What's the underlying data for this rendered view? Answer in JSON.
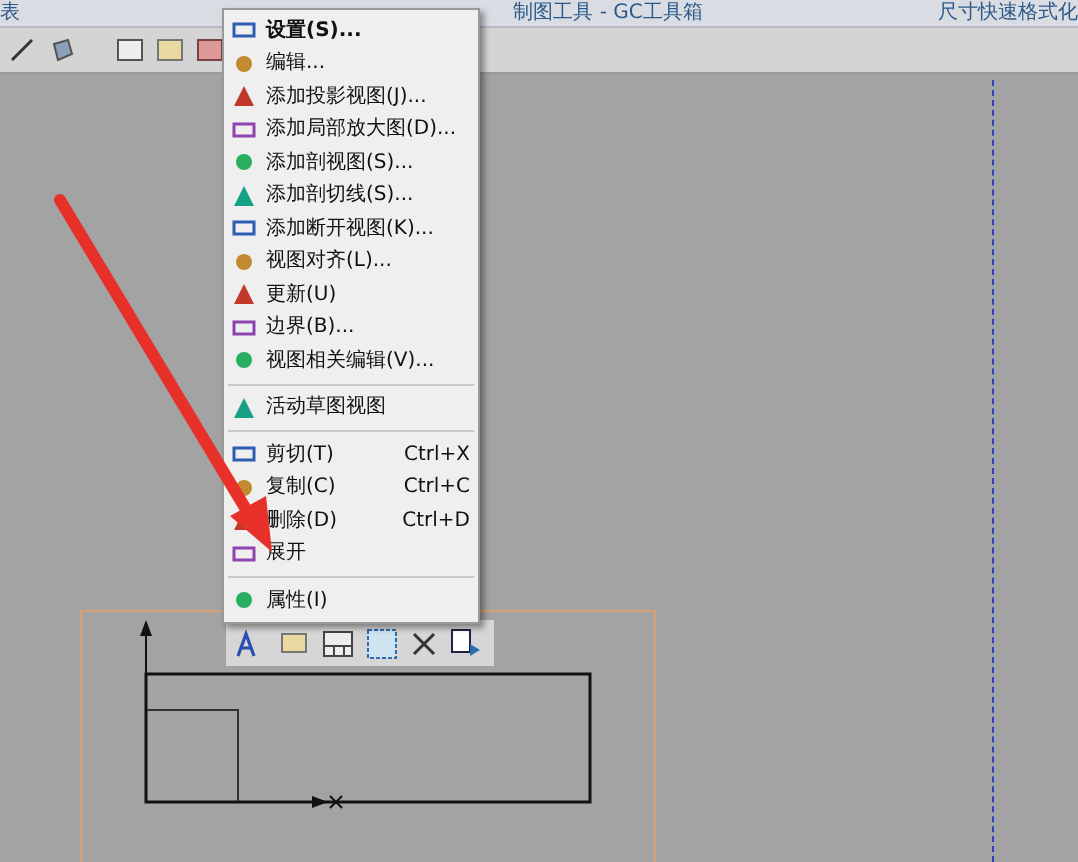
{
  "top_bar": {
    "segments": [
      {
        "text": "表"
      },
      {
        "text": "制图工具 - GC工具箱"
      },
      {
        "text": "尺寸快速格式化"
      }
    ]
  },
  "context_menu": {
    "items": [
      {
        "kind": "item",
        "label": "设置(S)...",
        "default": true
      },
      {
        "kind": "item",
        "label": "编辑...",
        "default": false
      },
      {
        "kind": "item",
        "label": "添加投影视图(J)...",
        "default": false
      },
      {
        "kind": "item",
        "label": "添加局部放大图(D)...",
        "default": false
      },
      {
        "kind": "item",
        "label": "添加剖视图(S)...",
        "default": false
      },
      {
        "kind": "item",
        "label": "添加剖切线(S)...",
        "default": false
      },
      {
        "kind": "item",
        "label": "添加断开视图(K)...",
        "default": false
      },
      {
        "kind": "item",
        "label": "视图对齐(L)...",
        "default": false
      },
      {
        "kind": "item",
        "label": "更新(U)",
        "default": false
      },
      {
        "kind": "item",
        "label": "边界(B)...",
        "default": false
      },
      {
        "kind": "item",
        "label": "视图相关编辑(V)...",
        "default": false
      },
      {
        "kind": "separator"
      },
      {
        "kind": "item",
        "label": "活动草图视图",
        "default": false
      },
      {
        "kind": "separator"
      },
      {
        "kind": "item",
        "label": "剪切(T)",
        "shortcut": "Ctrl+X",
        "default": false
      },
      {
        "kind": "item",
        "label": "复制(C)",
        "shortcut": "Ctrl+C",
        "default": false
      },
      {
        "kind": "item",
        "label": "删除(D)",
        "shortcut": "Ctrl+D",
        "default": false
      },
      {
        "kind": "item",
        "label": "展开",
        "default": false
      },
      {
        "kind": "separator"
      },
      {
        "kind": "item",
        "label": "属性(I)",
        "default": false
      }
    ]
  }
}
